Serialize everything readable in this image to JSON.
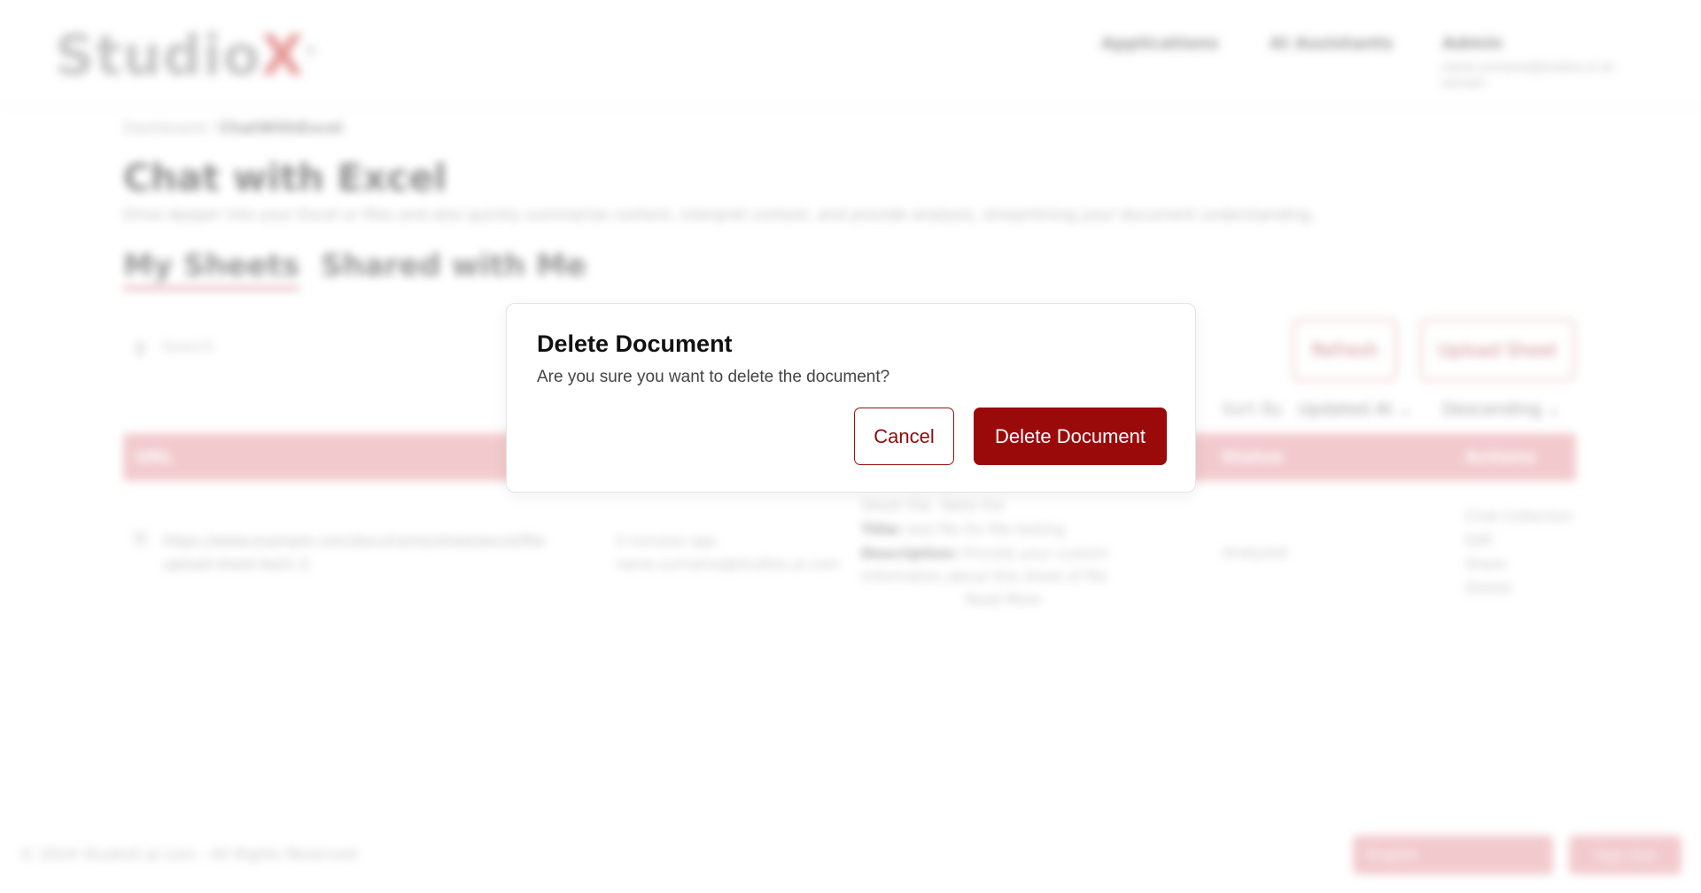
{
  "header": {
    "logo_text": "Studio",
    "logo_x": "X",
    "logo_mark": "®",
    "nav": [
      "Applications",
      "AI Assistants",
      "Admin"
    ],
    "admin_subtitle": "name.surname@studiox.ai an domain"
  },
  "breadcrumb": {
    "root": "Dashboard",
    "separator": "/",
    "current": "ChatWithExcel"
  },
  "page": {
    "title": "Chat with Excel",
    "description": "Drive deeper into your Excel or files and also quickly summarize content, interpret context, and provide analysis, streamlining your document understanding."
  },
  "tabs": [
    "My Sheets",
    "Shared with Me"
  ],
  "toolbar": {
    "search_placeholder": "Search",
    "refresh_label": "Refresh",
    "upload_label": "Upload Sheet",
    "sort_label": "Sort By",
    "sort_value": "Updated At",
    "order_value": "Descending"
  },
  "table": {
    "headers": [
      "URL",
      "Status",
      "Actions"
    ],
    "row": {
      "url": "https://www.example.com/documents/sheet/excel/file-upload-sheet-ba2c-1",
      "time_1": "3 minutes ago",
      "time_2": "name.surname@studiox.ai.com",
      "meta_title_label": "Title:",
      "meta_title": "test file for file-testing",
      "meta_desc_label": "Description:",
      "meta_desc": "Provide your custom information about this sheet of file",
      "meta_more": "Read More",
      "meta_header": "Sheet File: Table the",
      "status": "Analyzed",
      "actions": [
        "Chat Collection",
        "Edit",
        "Share",
        "Delete"
      ]
    }
  },
  "footer": {
    "copyright": "© 2024 StudioX.ai.com - All Rights Reserved",
    "language": "English",
    "signout": "Sign Out"
  },
  "modal": {
    "title": "Delete Document",
    "message": "Are you sure you want to delete the document?",
    "cancel_label": "Cancel",
    "confirm_label": "Delete Document"
  },
  "colors": {
    "brand": "#9b0a0a",
    "brand_light": "#e8a0a6"
  }
}
